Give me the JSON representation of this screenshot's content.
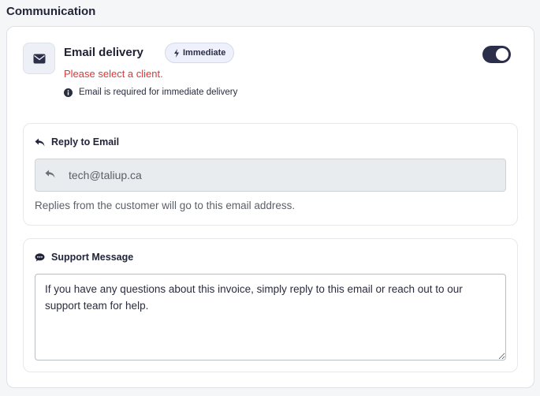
{
  "section": {
    "title": "Communication"
  },
  "email": {
    "icon": "envelope-icon",
    "title": "Email delivery",
    "badge": "Immediate",
    "badge_icon": "bolt-icon",
    "error": "Please select a client.",
    "note": "Email is required for immediate delivery",
    "toggle_on": true,
    "accent_color": "#2c2f4a",
    "error_color": "#d43a3a"
  },
  "reply": {
    "title": "Reply to Email",
    "icon": "reply-icon",
    "value": "tech@taliup.ca",
    "help": "Replies from the customer will go to this email address."
  },
  "support": {
    "title": "Support Message",
    "icon": "comment-icon",
    "message": "If you have any questions about this invoice, simply reply to this email or reach out to our support team for help."
  }
}
